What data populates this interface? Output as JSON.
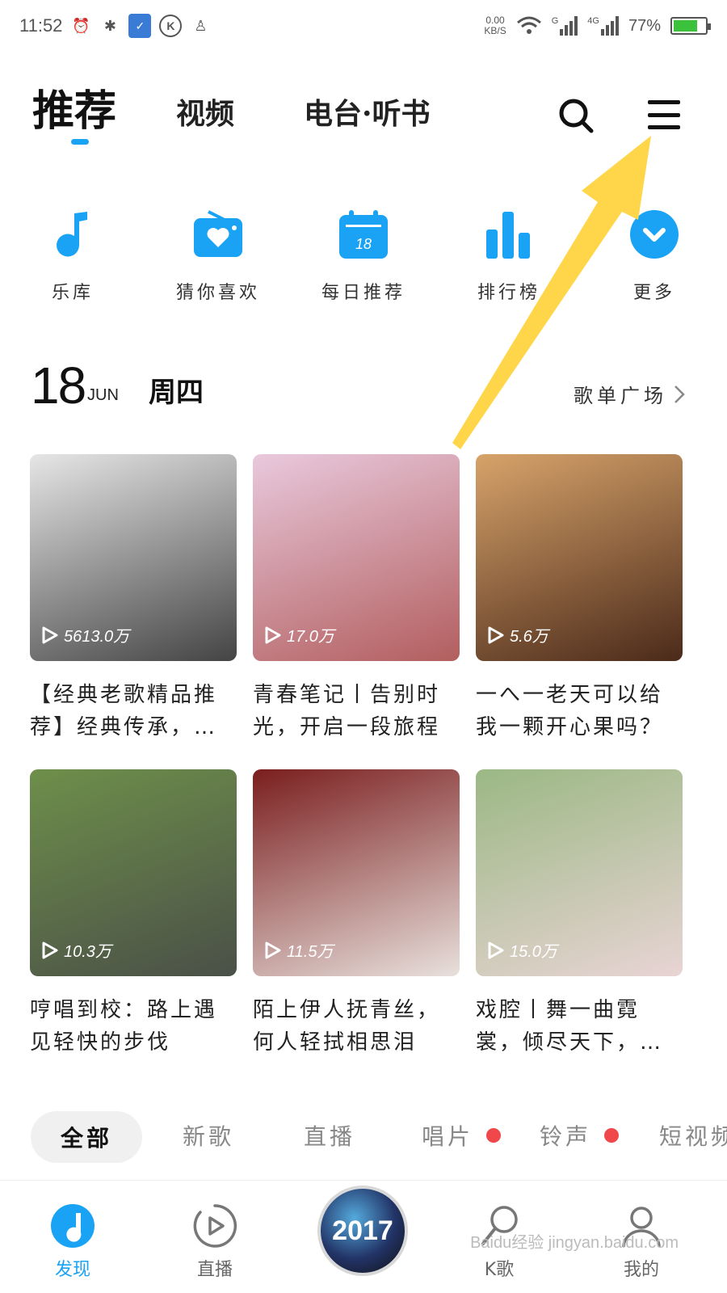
{
  "status_bar": {
    "time": "11:52",
    "net_speed_value": "0.00",
    "net_speed_unit": "KB/S",
    "signal_1_label": "G",
    "signal_2_label": "4G",
    "battery": "77%",
    "battery_level": 0.77
  },
  "top_nav": {
    "tabs": [
      {
        "label": "推荐"
      },
      {
        "label": "视频"
      },
      {
        "label": "电台·听书"
      }
    ]
  },
  "quick_entries": [
    {
      "label": "乐库",
      "icon": "music-note-icon"
    },
    {
      "label": "猜你喜欢",
      "icon": "radio-heart-icon"
    },
    {
      "label": "每日推荐",
      "icon": "calendar-icon",
      "badge": "18"
    },
    {
      "label": "排行榜",
      "icon": "bar-chart-icon"
    },
    {
      "label": "更多",
      "icon": "chevron-down-circle-icon"
    }
  ],
  "date": {
    "day": "18",
    "month": "JUN",
    "weekday": "周四",
    "plaza_label": "歌单广场"
  },
  "playlists": [
    {
      "plays": "5613.0万",
      "title": "【经典老歌精品推荐】经典传承，…",
      "colors": [
        "#e6e6e6",
        "#444444"
      ]
    },
    {
      "plays": "17.0万",
      "title": "青春笔记丨告别时光，开启一段旅程",
      "colors": [
        "#e9c9dd",
        "#b25e5e"
      ]
    },
    {
      "plays": "5.6万",
      "title": "一へ一老天可以给我一颗开心果吗？",
      "colors": [
        "#d7a36a",
        "#4b2a1a"
      ]
    },
    {
      "plays": "10.3万",
      "title": "哼唱到校：路上遇见轻快的步伐",
      "colors": [
        "#6e8f4a",
        "#4a5048"
      ]
    },
    {
      "plays": "11.5万",
      "title": "陌上伊人抚青丝，何人轻拭相思泪",
      "colors": [
        "#7a1e1e",
        "#e8e0dc"
      ]
    },
    {
      "plays": "15.0万",
      "title": "戏腔丨舞一曲霓裳，倾尽天下，…",
      "colors": [
        "#9bb884",
        "#e8d4d4"
      ]
    }
  ],
  "categories": [
    {
      "label": "全部",
      "dot": false
    },
    {
      "label": "新歌",
      "dot": false
    },
    {
      "label": "直播",
      "dot": false
    },
    {
      "label": "唱片",
      "dot": true
    },
    {
      "label": "铃声",
      "dot": true
    },
    {
      "label": "短视频",
      "dot": false
    }
  ],
  "bottom_nav": {
    "items": [
      {
        "label": "发现"
      },
      {
        "label": "直播"
      },
      {
        "label": "2017"
      },
      {
        "label": "K歌"
      },
      {
        "label": "我的"
      }
    ],
    "watermark": "Baidu经验 jingyan.baidu.com"
  },
  "colors": {
    "accent": "#1aa3f5",
    "annotation_arrow": "#ffd54a",
    "badge_red": "#f0474b"
  }
}
